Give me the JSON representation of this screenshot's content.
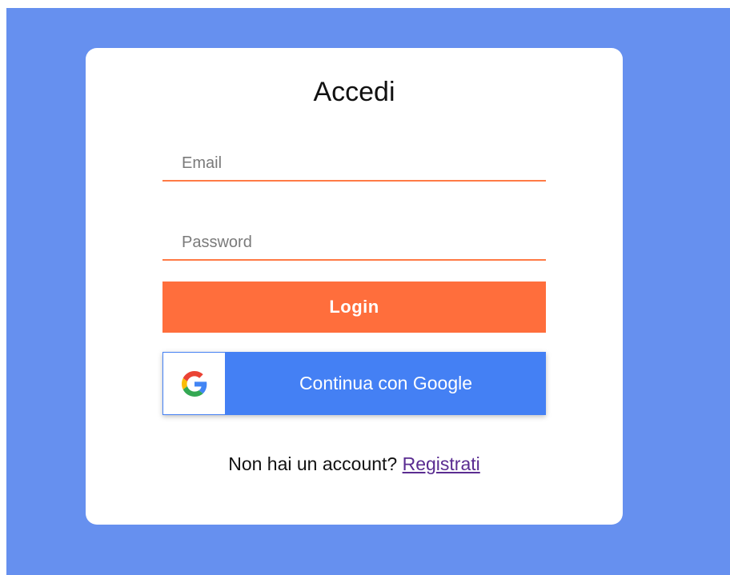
{
  "login": {
    "title": "Accedi",
    "email_placeholder": "Email",
    "email_value": "",
    "password_placeholder": "Password",
    "password_value": "",
    "login_button_label": "Login",
    "google_button_label": "Continua con Google",
    "google_icon": "google-g-icon",
    "footer_text": "Non hai un account?",
    "register_link_label": "Registrati"
  },
  "colors": {
    "background": "#6690ef",
    "card": "#ffffff",
    "accent": "#ff6e3c",
    "google_blue": "#4480f4",
    "link": "#5a2c91"
  }
}
